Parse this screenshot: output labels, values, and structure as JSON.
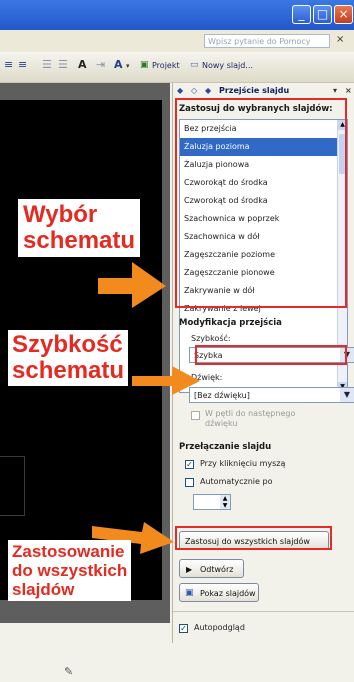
{
  "window": {
    "minimize": "_",
    "maximize": "□",
    "close": "×"
  },
  "help": {
    "placeholder": "Wpisz pytanie do Pomocy",
    "close": "×"
  },
  "toolbar": {
    "project_label": "Projekt",
    "new_slide_label": "Nowy slajd..."
  },
  "panel": {
    "header": "Przejście slajdu",
    "apply_title": "Zastosuj do wybranych slajdów:",
    "transitions": [
      "Bez przejścia",
      "Żaluzja pozioma",
      "Żaluzja pionowa",
      "Czworokąt do środka",
      "Czworokąt od środka",
      "Szachownica w poprzek",
      "Szachownica w dół",
      "Zagęszczanie poziome",
      "Zagęszczanie pionowe",
      "Zakrywanie w dół",
      "Zakrywanie z lewej"
    ],
    "selected_index": 1,
    "modify_title": "Modyfikacja przejścia",
    "speed_label": "Szybkość:",
    "speed_value": "Szybka",
    "sound_label": "Dźwięk:",
    "sound_value": "[Bez dźwięku]",
    "loop_label": "W pętli do następnego dźwięku",
    "advance_title": "Przełączanie slajdu",
    "on_click_label": "Przy kliknięciu myszą",
    "on_click_checked": true,
    "auto_label": "Automatycznie po",
    "auto_checked": false,
    "apply_all_label": "Zastosuj do wszystkich slajdów",
    "play_label": "Odtwórz",
    "slideshow_label": "Pokaz slajdów",
    "autopreview_label": "Autopodgląd",
    "autopreview_checked": true
  },
  "annotations": {
    "scheme_line1": "Wybór",
    "scheme_line2": "schematu",
    "speed_line1": "Szybkość",
    "speed_line2": "schematu",
    "applyall_line1": "Zastosowanie",
    "applyall_line2": "do wszystkich",
    "applyall_line3": "slajdów"
  },
  "colors": {
    "annotation_red": "#e42b21",
    "arrow_orange": "#f28a1e",
    "selection_blue": "#3169c6"
  }
}
